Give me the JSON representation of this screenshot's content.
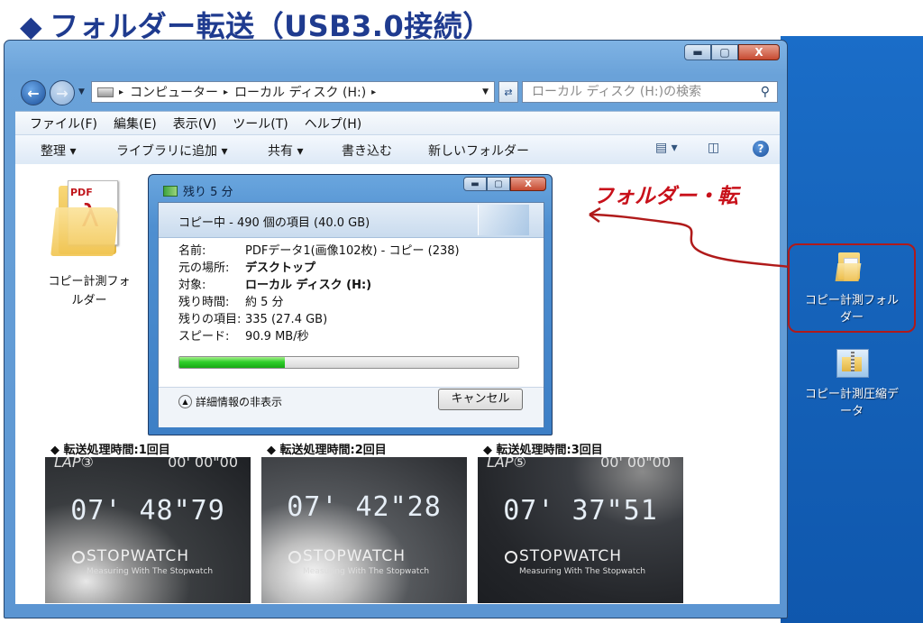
{
  "slide": {
    "title": "フォルダー転送（USB3.0接続）",
    "title_mark": "◆"
  },
  "window": {
    "min": "▬",
    "max": "▢",
    "close": "X"
  },
  "address": {
    "crumbs": [
      "コンピューター",
      "ローカル ディスク (H:)"
    ],
    "separator": "▸",
    "search_placeholder": "ローカル ディスク (H:)の検索"
  },
  "menu": [
    "ファイル(F)",
    "編集(E)",
    "表示(V)",
    "ツール(T)",
    "ヘルプ(H)"
  ],
  "toolbar": {
    "organize": "整理 ▾",
    "add_library": "ライブラリに追加 ▾",
    "share": "共有 ▾",
    "burn": "書き込む",
    "new_folder": "新しいフォルダー"
  },
  "folder_item": {
    "label_line1": "コピー計測フォ",
    "label_line2": "ルダー",
    "pdf_text": "PDF"
  },
  "dialog": {
    "title": "残り 5 分",
    "header": "コピー中 - 490 個の項目 (40.0 GB)",
    "fields": [
      {
        "k": "名前:",
        "v": "PDFデータ1(画像102枚) - コピー (238)",
        "bold": false
      },
      {
        "k": "元の場所:",
        "v": "デスクトップ",
        "bold": true
      },
      {
        "k": "対象:",
        "v": "ローカル ディスク (H:)",
        "bold": true
      },
      {
        "k": "残り時間:",
        "v": "約 5 分",
        "bold": false
      },
      {
        "k": "残りの項目:",
        "v": "335 (27.4 GB)",
        "bold": false
      },
      {
        "k": "スピード:",
        "v": "90.9 MB/秒",
        "bold": false
      }
    ],
    "progress_pct": 31,
    "details_toggle": "詳細情報の非表示",
    "cancel": "キャンセル"
  },
  "callout": {
    "text": "フォルダー・転",
    "color": "#c8101a"
  },
  "desktop": {
    "folder_label_1": "コピー計測フォル",
    "folder_label_2": "ダー",
    "zip_label_1": "コピー計測圧縮デ",
    "zip_label_2": "ータ"
  },
  "stopwatch": [
    {
      "label": "◆ 転送処理時間:1回目",
      "lap": "LAP③",
      "lapv": "00' 00\"00",
      "time": "07' 48\"79",
      "brand": "STOPWATCH",
      "sub": "Measuring With The Stopwatch"
    },
    {
      "label": "◆ 転送処理時間:2回目",
      "lap": "",
      "lapv": "",
      "time": "07' 42\"28",
      "brand": "STOPWATCH",
      "sub": "Measuring With The Stopwatch"
    },
    {
      "label": "◆ 転送処理時間:3回目",
      "lap": "LAP⑤",
      "lapv": "00' 00\"00",
      "time": "07' 37\"51",
      "brand": "STOPWATCH",
      "sub": "Measuring With The Stopwatch"
    }
  ]
}
